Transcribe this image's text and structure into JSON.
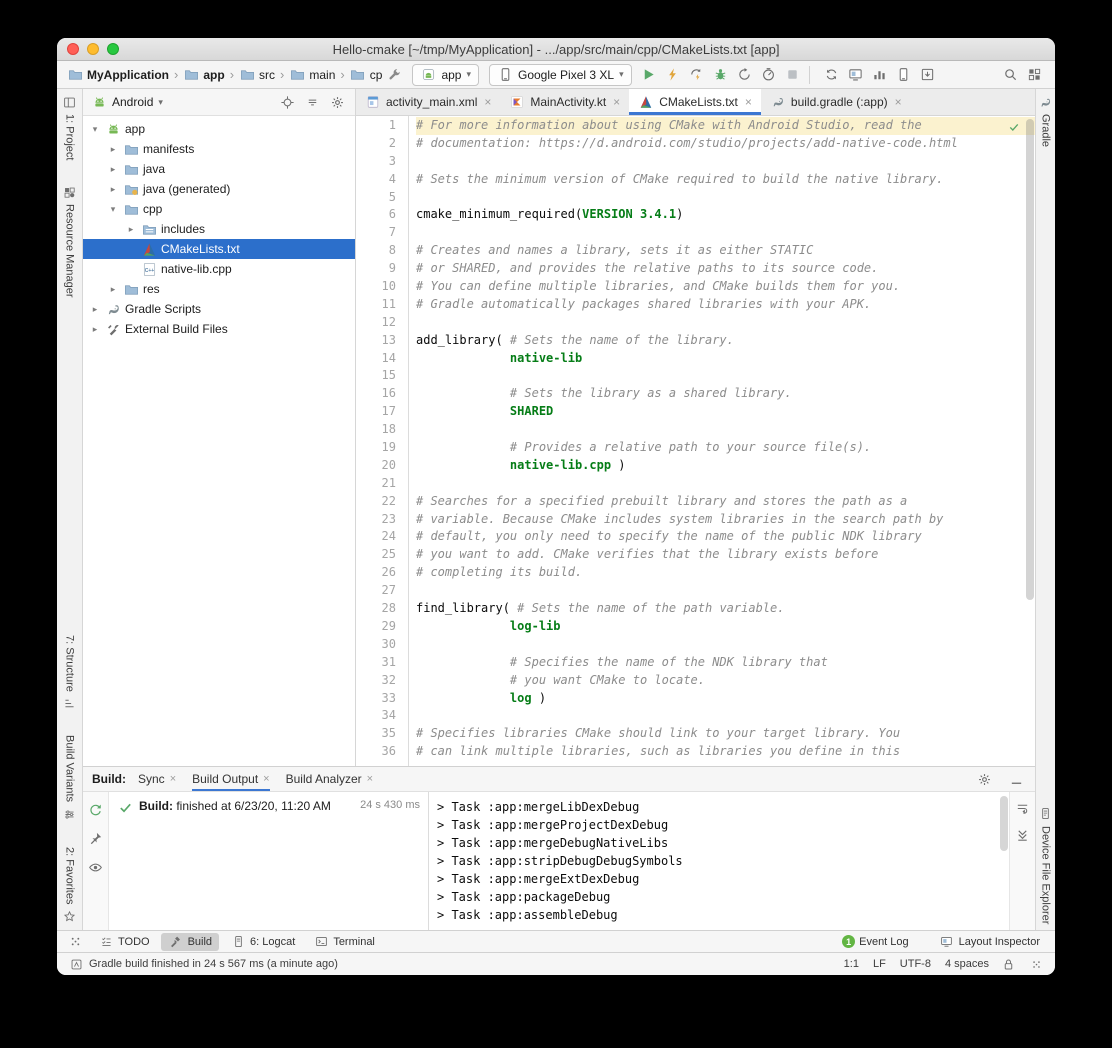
{
  "window": {
    "title": "Hello-cmake [~/tmp/MyApplication] - .../app/src/main/cpp/CMakeLists.txt [app]"
  },
  "toolbar": {
    "breadcrumbs": [
      {
        "label": "MyApplication",
        "bold": true
      },
      {
        "label": "app",
        "bold": true
      },
      {
        "label": "src",
        "bold": false
      },
      {
        "label": "main",
        "bold": false
      },
      {
        "label": "cp",
        "bold": false
      }
    ],
    "run_config_label": "app",
    "device_label": "Google Pixel 3 XL",
    "run_icons": [
      "run",
      "apply-changes",
      "apply-code-changes",
      "debug",
      "attach-debugger",
      "profile",
      "stop"
    ],
    "tool_icons": [
      "sync-project",
      "layout-inspector",
      "profiler",
      "device-manager",
      "sdk-manager"
    ],
    "right_icons": [
      "search-everywhere",
      "project-structure"
    ]
  },
  "left_strip": {
    "top": [
      {
        "label": "1: Project",
        "icon": "project"
      },
      {
        "label": "Resource Manager",
        "icon": "resource-manager"
      }
    ],
    "bottom": [
      {
        "label": "7: Structure",
        "icon": "structure"
      },
      {
        "label": "Build Variants",
        "icon": "build-variants"
      },
      {
        "label": "2: Favorites",
        "icon": "favorites"
      }
    ]
  },
  "right_strip": {
    "top": [
      {
        "label": "Gradle",
        "icon": "gradle"
      }
    ],
    "bottom": [
      {
        "label": "Device File Explorer",
        "icon": "device-file-explorer"
      }
    ]
  },
  "project_pane": {
    "scope": "Android",
    "tree": [
      {
        "label": "app",
        "level": 0,
        "icon": "android-module",
        "chevron": "down"
      },
      {
        "label": "manifests",
        "level": 1,
        "icon": "folder",
        "chevron": "right"
      },
      {
        "label": "java",
        "level": 1,
        "icon": "folder",
        "chevron": "right"
      },
      {
        "label": "java (generated)",
        "level": 1,
        "icon": "folder-generated",
        "chevron": "right"
      },
      {
        "label": "cpp",
        "level": 1,
        "icon": "folder",
        "chevron": "down"
      },
      {
        "label": "includes",
        "level": 2,
        "icon": "includes",
        "chevron": "right"
      },
      {
        "label": "CMakeLists.txt",
        "level": 2,
        "icon": "cmake",
        "chevron": "none",
        "selected": true
      },
      {
        "label": "native-lib.cpp",
        "level": 2,
        "icon": "cpp-file",
        "chevron": "none"
      },
      {
        "label": "res",
        "level": 1,
        "icon": "folder",
        "chevron": "right"
      },
      {
        "label": "Gradle Scripts",
        "level": 0,
        "icon": "gradle",
        "chevron": "right"
      },
      {
        "label": "External Build Files",
        "level": 0,
        "icon": "external-build",
        "chevron": "right"
      }
    ]
  },
  "editor": {
    "tabs": [
      {
        "label": "activity_main.xml",
        "icon": "xml-file",
        "active": false
      },
      {
        "label": "MainActivity.kt",
        "icon": "kotlin-file",
        "active": false
      },
      {
        "label": "CMakeLists.txt",
        "icon": "cmake",
        "active": true
      },
      {
        "label": "build.gradle (:app)",
        "icon": "gradle",
        "active": false
      }
    ],
    "lines": [
      {
        "n": 1,
        "hl": true,
        "s": [
          [
            "# For more information about using CMake with Android Studio, read the",
            "c"
          ]
        ]
      },
      {
        "n": 2,
        "s": [
          [
            "# documentation: https://d.android.com/studio/projects/add-native-code.html",
            "c"
          ]
        ]
      },
      {
        "n": 3,
        "s": []
      },
      {
        "n": 4,
        "s": [
          [
            "# Sets the minimum version of CMake required to build the native library.",
            "c"
          ]
        ]
      },
      {
        "n": 5,
        "s": []
      },
      {
        "n": 6,
        "s": [
          [
            "cmake_minimum_required(",
            "p"
          ],
          [
            "VERSION 3.4.1",
            "k"
          ],
          [
            ")",
            "p"
          ]
        ]
      },
      {
        "n": 7,
        "s": []
      },
      {
        "n": 8,
        "s": [
          [
            "# Creates and names a library, sets it as either STATIC",
            "c"
          ]
        ]
      },
      {
        "n": 9,
        "s": [
          [
            "# or SHARED, and provides the relative paths to its source code.",
            "c"
          ]
        ]
      },
      {
        "n": 10,
        "s": [
          [
            "# You can define multiple libraries, and CMake builds them for you.",
            "c"
          ]
        ]
      },
      {
        "n": 11,
        "s": [
          [
            "# Gradle automatically packages shared libraries with your APK.",
            "c"
          ]
        ]
      },
      {
        "n": 12,
        "s": []
      },
      {
        "n": 13,
        "s": [
          [
            "add_library( ",
            "p"
          ],
          [
            "# Sets the name of the library.",
            "c"
          ]
        ]
      },
      {
        "n": 14,
        "s": [
          [
            "             ",
            "p"
          ],
          [
            "native-lib",
            "k"
          ]
        ]
      },
      {
        "n": 15,
        "s": []
      },
      {
        "n": 16,
        "s": [
          [
            "             ",
            "p"
          ],
          [
            "# Sets the library as a shared library.",
            "c"
          ]
        ]
      },
      {
        "n": 17,
        "s": [
          [
            "             ",
            "p"
          ],
          [
            "SHARED",
            "k"
          ]
        ]
      },
      {
        "n": 18,
        "s": []
      },
      {
        "n": 19,
        "s": [
          [
            "             ",
            "p"
          ],
          [
            "# Provides a relative path to your source file(s).",
            "c"
          ]
        ]
      },
      {
        "n": 20,
        "s": [
          [
            "             ",
            "p"
          ],
          [
            "native-lib.cpp",
            "k"
          ],
          [
            " )",
            "p"
          ]
        ]
      },
      {
        "n": 21,
        "s": []
      },
      {
        "n": 22,
        "s": [
          [
            "# Searches for a specified prebuilt library and stores the path as a",
            "c"
          ]
        ]
      },
      {
        "n": 23,
        "s": [
          [
            "# variable. Because CMake includes system libraries in the search path by",
            "c"
          ]
        ]
      },
      {
        "n": 24,
        "s": [
          [
            "# default, you only need to specify the name of the public NDK library",
            "c"
          ]
        ]
      },
      {
        "n": 25,
        "s": [
          [
            "# you want to add. CMake verifies that the library exists before",
            "c"
          ]
        ]
      },
      {
        "n": 26,
        "s": [
          [
            "# completing its build.",
            "c"
          ]
        ]
      },
      {
        "n": 27,
        "s": []
      },
      {
        "n": 28,
        "s": [
          [
            "find_library( ",
            "p"
          ],
          [
            "# Sets the name of the path variable.",
            "c"
          ]
        ]
      },
      {
        "n": 29,
        "s": [
          [
            "             ",
            "p"
          ],
          [
            "log-lib",
            "k"
          ]
        ]
      },
      {
        "n": 30,
        "s": []
      },
      {
        "n": 31,
        "s": [
          [
            "             ",
            "p"
          ],
          [
            "# Specifies the name of the NDK library that",
            "c"
          ]
        ]
      },
      {
        "n": 32,
        "s": [
          [
            "             ",
            "p"
          ],
          [
            "# you want CMake to locate.",
            "c"
          ]
        ]
      },
      {
        "n": 33,
        "s": [
          [
            "             ",
            "p"
          ],
          [
            "log",
            "k"
          ],
          [
            " )",
            "p"
          ]
        ]
      },
      {
        "n": 34,
        "s": []
      },
      {
        "n": 35,
        "s": [
          [
            "# Specifies libraries CMake should link to your target library. You",
            "c"
          ]
        ]
      },
      {
        "n": 36,
        "s": [
          [
            "# can link multiple libraries, such as libraries you define in this",
            "c"
          ]
        ]
      }
    ]
  },
  "build_panel": {
    "label": "Build:",
    "tabs": [
      {
        "label": "Sync",
        "active": false
      },
      {
        "label": "Build Output",
        "active": true
      },
      {
        "label": "Build Analyzer",
        "active": false
      }
    ],
    "side_icons": [
      "rerun-build",
      "pin",
      "filter-eye"
    ],
    "console_icons": [
      "soft-wrap",
      "scroll-to-end"
    ],
    "status_prefix": "Build:",
    "status_rest": " finished at 6/23/20, 11:20 AM",
    "duration": "24 s 430 ms",
    "console_lines": [
      "> Task :app:mergeLibDexDebug",
      "> Task :app:mergeProjectDexDebug",
      "> Task :app:mergeDebugNativeLibs",
      "> Task :app:stripDebugDebugSymbols",
      "> Task :app:mergeExtDexDebug",
      "> Task :app:packageDebug",
      "> Task :app:assembleDebug"
    ]
  },
  "bottom_bar": {
    "left_items": [
      {
        "label": "TODO",
        "icon": "todo",
        "active": false
      },
      {
        "label": "Build",
        "icon": "build-hammer",
        "active": true
      },
      {
        "label": "6: Logcat",
        "icon": "logcat",
        "active": false
      },
      {
        "label": "Terminal",
        "icon": "terminal",
        "active": false
      }
    ],
    "right_items": [
      {
        "label": "Event Log",
        "icon": "event-log",
        "badge": "1"
      },
      {
        "label": "Layout Inspector",
        "icon": "layout-inspector"
      }
    ]
  },
  "status_bar": {
    "message": "Gradle build finished in 24 s 567 ms (a minute ago)",
    "caret": "1:1",
    "line_sep": "LF",
    "encoding": "UTF-8",
    "indent": "4 spaces"
  }
}
